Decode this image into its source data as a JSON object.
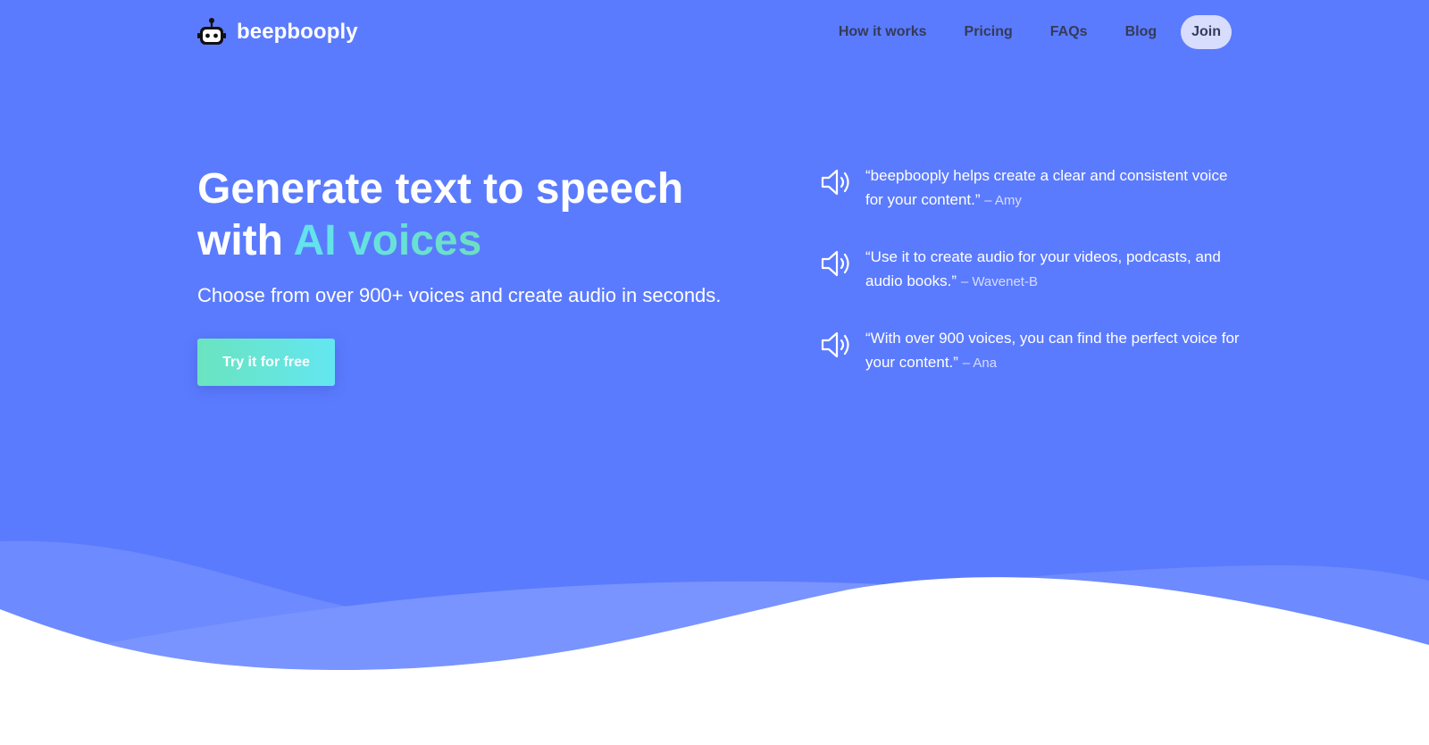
{
  "brand": {
    "name": "beepbooply",
    "logo_icon": "robot-icon"
  },
  "nav": {
    "links": [
      "How it works",
      "Pricing",
      "FAQs",
      "Blog"
    ],
    "join_label": "Join"
  },
  "hero": {
    "headline_part1": "Generate text to speech",
    "headline_part2": "with ",
    "headline_accent": "AI voices",
    "subtitle": "Choose from over 900+ voices and create audio in seconds.",
    "cta_label": "Try it for free"
  },
  "testimonials": [
    {
      "icon": "speaker-icon",
      "quote": "“beepbooply helps create a clear and consistent voice for your content.”",
      "author": "– Amy"
    },
    {
      "icon": "speaker-icon",
      "quote": "“Use it to create audio for your videos, podcasts, and audio books.”",
      "author": "– Wavenet-B"
    },
    {
      "icon": "speaker-icon",
      "quote": "“With over 900 voices, you can find the perfect voice for your content.”",
      "author": "– Ana"
    }
  ],
  "colors": {
    "background": "#5b7bfe",
    "nav_text": "#343b58",
    "join_bg": "#d8dcfd",
    "accent_start": "#62e3ef",
    "accent_end": "#6de0c0",
    "cta_start": "#6ae4bf",
    "cta_end": "#63e6f1"
  }
}
